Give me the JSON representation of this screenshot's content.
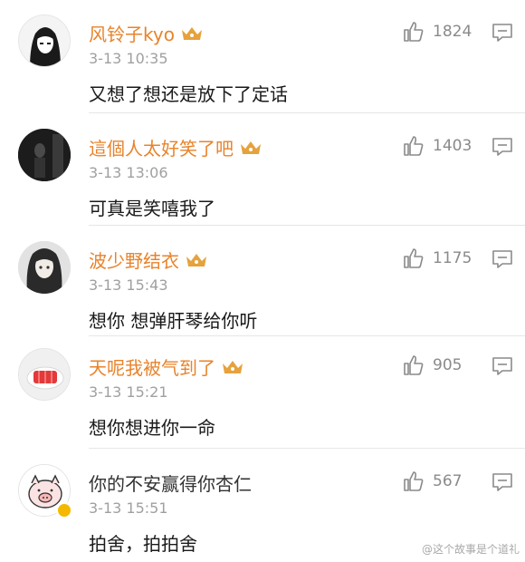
{
  "colors": {
    "username": "#e8832a",
    "text": "#1a1a1a",
    "meta": "#a0a0a0",
    "icon": "#8a8a8a",
    "badge": "#e6a23c"
  },
  "comments": [
    {
      "username": "风铃子kyo",
      "time": "3-13 10:35",
      "text": "又想了想还是放下了定话",
      "likes": "1824",
      "avatar": "cartoon-girl-black-hair",
      "crown": true
    },
    {
      "username": "這個人太好笑了吧",
      "time": "3-13 13:06",
      "text": "可真是笑嘻我了",
      "likes": "1403",
      "avatar": "dark-figure-portrait",
      "crown": true
    },
    {
      "username": "波少野结衣",
      "time": "3-13 15:43",
      "text": "想你 想弹肝琴给你听",
      "likes": "1175",
      "avatar": "anime-girl-long-hair",
      "crown": true
    },
    {
      "username": "天呢我被气到了",
      "time": "3-13 15:21",
      "text": "想你想进你一命",
      "likes": "905",
      "avatar": "food-on-plate",
      "crown": true
    },
    {
      "username": "你的不安赢得你杏仁",
      "time": "3-13 15:51",
      "text": "拍舍，拍拍舍",
      "likes": "567",
      "avatar": "cartoon-pig",
      "crown": false
    }
  ],
  "watermark": "@这个故事是个道礼"
}
